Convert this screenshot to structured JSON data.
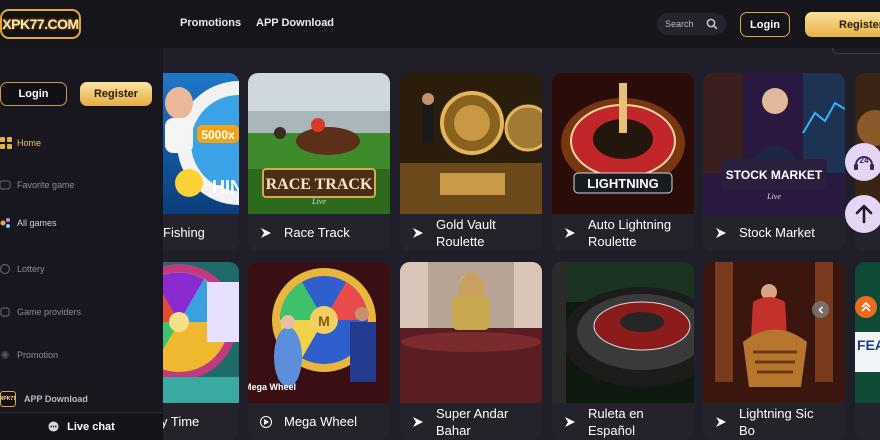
{
  "header": {
    "logo_text": "XPK77.COM",
    "nav": [
      "Promotions",
      "APP Download"
    ],
    "search_placeholder": "Search",
    "login_label": "Login",
    "register_label": "Register"
  },
  "sidebar": {
    "login_label": "Login",
    "register_label": "Register",
    "items": [
      {
        "label": "Home",
        "icon": "home-grid-icon"
      },
      {
        "label": "Favorite game",
        "icon": "heart-icon"
      },
      {
        "label": "All games",
        "icon": "joystick-icon"
      },
      {
        "label": "Lottery",
        "icon": "lottery-ball-icon"
      },
      {
        "label": "Game providers",
        "icon": "provider-icon"
      },
      {
        "label": "Promotion",
        "icon": "gift-icon"
      }
    ],
    "app_logo_text": "XPK77",
    "app_download_label": "APP Download",
    "live_chat_label": "Live chat"
  },
  "games": {
    "row1": [
      {
        "title": "Fishing",
        "thumb_text": "5000x"
      },
      {
        "title": "Race Track",
        "thumb_text": "RACE TRACK",
        "thumb_sub": "Live"
      },
      {
        "title_line1": "Gold Vault",
        "title_line2": "Roulette"
      },
      {
        "title_line1": "Auto Lightning",
        "title_line2": "Roulette",
        "thumb_text": "LIGHTNING"
      },
      {
        "title": "Stock Market",
        "thumb_text": "STOCK MARKET",
        "thumb_sub": "Live"
      }
    ],
    "row2": [
      {
        "title": "y Time"
      },
      {
        "title": "Mega Wheel",
        "thumb_text": "Mega Wheel"
      },
      {
        "title_line1": "Super Andar",
        "title_line2": "Bahar"
      },
      {
        "title_line1": "Ruleta en",
        "title_line2": "Español"
      },
      {
        "title_line1": "Lightning Sic",
        "title_line2": "Bo"
      },
      {
        "thumb_text": "FEATUR GAM"
      }
    ]
  },
  "colors": {
    "accent_gold": "#e6b046",
    "bg": "#201f29",
    "sidebar_bg": "#181720",
    "card_bg": "#24232c"
  }
}
